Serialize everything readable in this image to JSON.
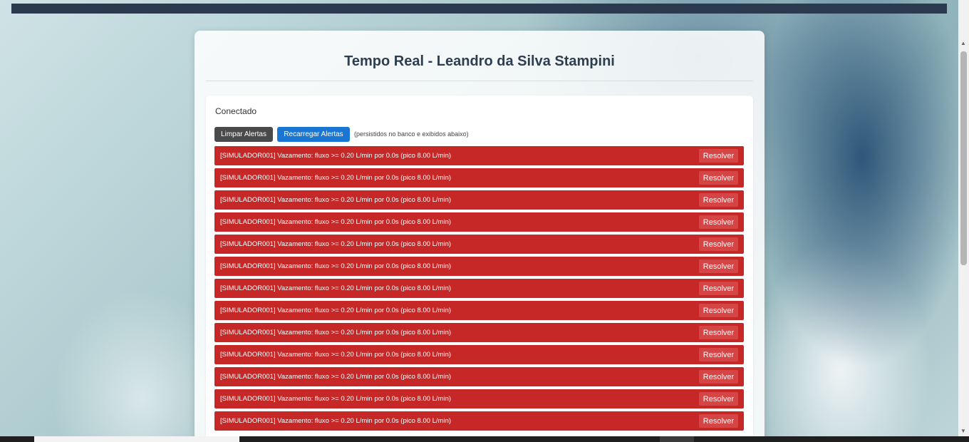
{
  "page": {
    "title": "Tempo Real - Leandro da Silva Stampini",
    "status": "Conectado"
  },
  "toolbar": {
    "clear_label": "Limpar Alertas",
    "reload_label": "Recarregar Alertas",
    "hint": "(persistidos no banco e exibidos abaixo)"
  },
  "alerts": [
    {
      "text": "[SIMULADOR001] Vazamento: fluxo >= 0.20 L/min por 0.0s (pico 8.00 L/min)",
      "action": "Resolver"
    },
    {
      "text": "[SIMULADOR001] Vazamento: fluxo >= 0.20 L/min por 0.0s (pico 8.00 L/min)",
      "action": "Resolver"
    },
    {
      "text": "[SIMULADOR001] Vazamento: fluxo >= 0.20 L/min por 0.0s (pico 8.00 L/min)",
      "action": "Resolver"
    },
    {
      "text": "[SIMULADOR001] Vazamento: fluxo >= 0.20 L/min por 0.0s (pico 8.00 L/min)",
      "action": "Resolver"
    },
    {
      "text": "[SIMULADOR001] Vazamento: fluxo >= 0.20 L/min por 0.0s (pico 8.00 L/min)",
      "action": "Resolver"
    },
    {
      "text": "[SIMULADOR001] Vazamento: fluxo >= 0.20 L/min por 0.0s (pico 8.00 L/min)",
      "action": "Resolver"
    },
    {
      "text": "[SIMULADOR001] Vazamento: fluxo >= 0.20 L/min por 0.0s (pico 8.00 L/min)",
      "action": "Resolver"
    },
    {
      "text": "[SIMULADOR001] Vazamento: fluxo >= 0.20 L/min por 0.0s (pico 8.00 L/min)",
      "action": "Resolver"
    },
    {
      "text": "[SIMULADOR001] Vazamento: fluxo >= 0.20 L/min por 0.0s (pico 8.00 L/min)",
      "action": "Resolver"
    },
    {
      "text": "[SIMULADOR001] Vazamento: fluxo >= 0.20 L/min por 0.0s (pico 8.00 L/min)",
      "action": "Resolver"
    },
    {
      "text": "[SIMULADOR001] Vazamento: fluxo >= 0.20 L/min por 0.0s (pico 8.00 L/min)",
      "action": "Resolver"
    },
    {
      "text": "[SIMULADOR001] Vazamento: fluxo >= 0.20 L/min por 0.0s (pico 8.00 L/min)",
      "action": "Resolver"
    },
    {
      "text": "[SIMULADOR001] Vazamento: fluxo >= 0.20 L/min por 0.0s (pico 8.00 L/min)",
      "action": "Resolver"
    }
  ],
  "colors": {
    "alert_bg": "#c62828",
    "resolve_bg": "#d64545",
    "reload_bg": "#1976d2",
    "clear_bg": "#4a4a4a",
    "title": "#2c3e50"
  }
}
